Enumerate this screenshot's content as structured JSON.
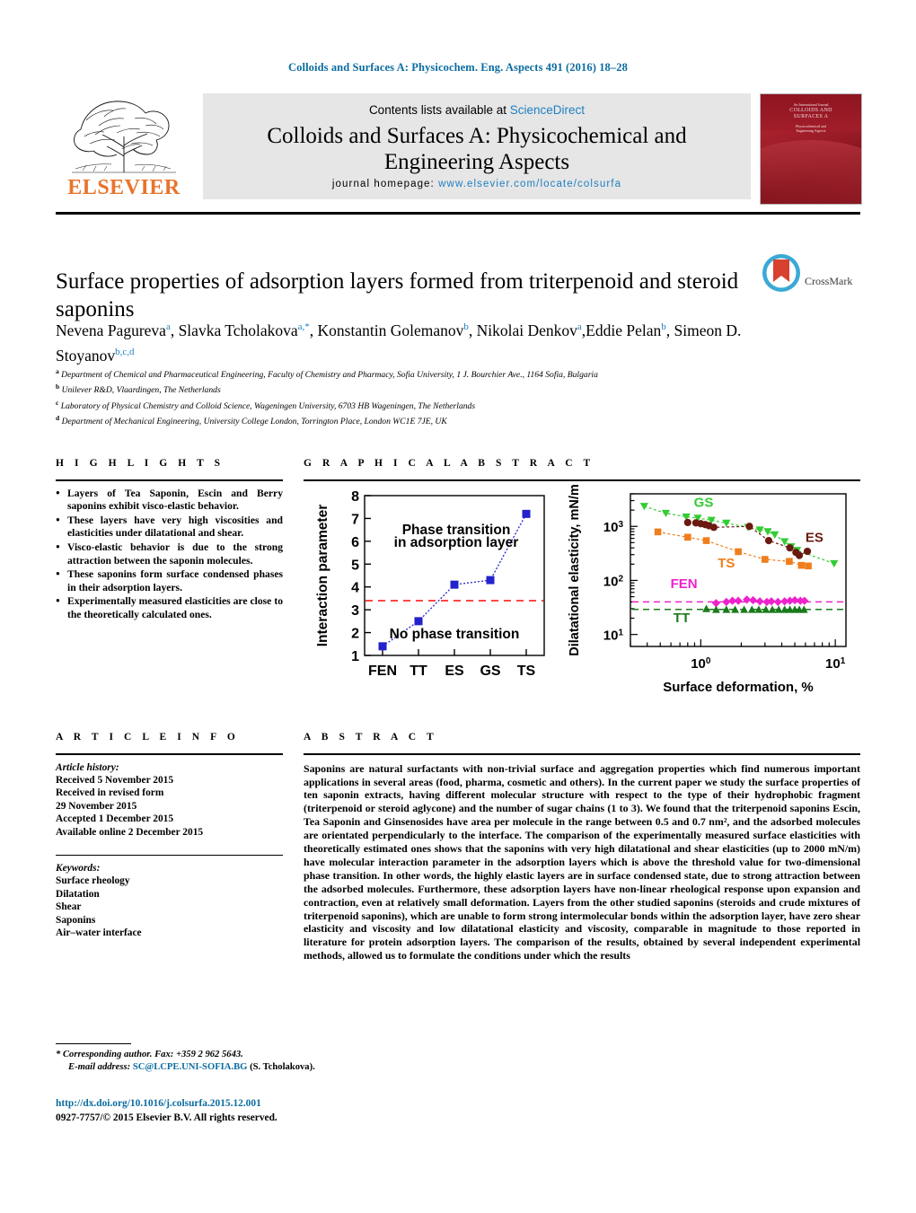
{
  "running_head": "Colloids and Surfaces A: Physicochem. Eng. Aspects 491 (2016) 18–28",
  "masthead": {
    "publisher": "ELSEVIER",
    "contents_prefix": "Contents lists available at ",
    "contents_link": "ScienceDirect",
    "journal_title_line1": "Colloids and Surfaces A: Physicochemical and",
    "journal_title_line2": "Engineering Aspects",
    "homepage_label": "journal homepage:",
    "homepage_url": "www.elsevier.com/locate/colsurfa",
    "cover_line1": "An International Journal",
    "cover_line2": "COLLOIDS AND",
    "cover_line3": "SURFACES A",
    "cover_line4": "Physicochemical and",
    "cover_line5": "Engineering Aspects"
  },
  "article": {
    "title": "Surface properties of adsorption layers formed from triterpenoid and steroid saponins",
    "authors": [
      {
        "name": "Nevena Pagureva",
        "sup": "a",
        "sep": ", "
      },
      {
        "name": "Slavka Tcholakova",
        "sup": "a,*",
        "sep": ", "
      },
      {
        "name": "Konstantin Golemanov",
        "sup": "b",
        "sep": ", "
      },
      {
        "name": "Nikolai Denkov",
        "sup": "a",
        "sep": ","
      },
      {
        "name": "Eddie Pelan",
        "sup": "b",
        "sep": ", "
      },
      {
        "name": "Simeon D. Stoyanov",
        "sup": "b,c,d",
        "sep": ""
      }
    ],
    "affiliations": [
      {
        "mark": "a",
        "text": "Department of Chemical and Pharmaceutical Engineering, Faculty of Chemistry and Pharmacy, Sofia University, 1 J. Bourchier Ave., 1164 Sofia, Bulgaria"
      },
      {
        "mark": "b",
        "text": "Unilever R&D, Vlaardingen, The Netherlands"
      },
      {
        "mark": "c",
        "text": "Laboratory of Physical Chemistry and Colloid Science, Wageningen University, 6703 HB Wageningen, The Netherlands"
      },
      {
        "mark": "d",
        "text": "Department of Mechanical Engineering, University College London, Torrington Place, London WC1E 7JE, UK"
      }
    ],
    "crossmark_label": "CrossMark"
  },
  "sections": {
    "highlights_heading": "H I G H L I G H T S",
    "graphical_abstract_heading": "G R A P H I C A L   A B S T R A C T",
    "article_info_heading": "A R T I C L E   I N F O",
    "abstract_heading": "A B S T R A C T"
  },
  "highlights": [
    "Layers of Tea Saponin, Escin and Berry saponins exhibit visco-elastic behavior.",
    "These layers have very high viscosities and elasticities under dilatational and shear.",
    "Visco-elastic behavior is due to the strong attraction between the saponin molecules.",
    "These saponins form surface condensed phases in their adsorption layers.",
    "Experimentally measured elasticities are close to the theoretically calculated ones."
  ],
  "article_info": {
    "history_label": "Article history:",
    "history": [
      "Received 5 November 2015",
      "Received in revised form",
      "29 November 2015",
      "Accepted 1 December 2015",
      "Available online 2 December 2015"
    ],
    "keywords_label": "Keywords:",
    "keywords": [
      "Surface rheology",
      "Dilatation",
      "Shear",
      "Saponins",
      "Air–water interface"
    ]
  },
  "abstract": "Saponins are natural surfactants with non-trivial surface and aggregation properties which find numerous important applications in several areas (food, pharma, cosmetic and others). In the current paper we study the surface properties of ten saponin extracts, having different molecular structure with respect to the type of their hydrophobic fragment (triterpenoid or steroid aglycone) and the number of sugar chains (1 to 3). We found that the triterpenoid saponins Escin, Tea Saponin and Ginsenosides have area per molecule in the range between 0.5 and 0.7 nm², and the adsorbed molecules are orientated perpendicularly to the interface. The comparison of the experimentally measured surface elasticities with theoretically estimated ones shows that the saponins with very high dilatational and shear elasticities (up to 2000 mN/m) have molecular interaction parameter in the adsorption layers which is above the threshold value for two-dimensional phase transition. In other words, the highly elastic layers are in surface condensed state, due to strong attraction between the adsorbed molecules. Furthermore, these adsorption layers have non-linear rheological response upon expansion and contraction, even at relatively small deformation. Layers from the other studied saponins (steroids and crude mixtures of triterpenoid saponins), which are unable to form strong intermolecular bonds within the adsorption layer, have zero shear elasticity and viscosity and low dilatational elasticity and viscosity, comparable in magnitude to those reported in literature for protein adsorption layers. The comparison of the results, obtained by several independent experimental methods, allowed us to formulate the conditions under which the results",
  "footer": {
    "corresponding_mark": "*",
    "corresponding": "Corresponding author. Fax: +359 2 962 5643.",
    "email_label": "E-mail address:",
    "email": "SC@LCPE.UNI-SOFIA.BG",
    "email_owner": "(S. Tcholakova).",
    "doi": "http://dx.doi.org/10.1016/j.colsurfa.2015.12.001",
    "copyright": "0927-7757/© 2015 Elsevier B.V. All rights reserved."
  },
  "chart_data": [
    {
      "type": "line",
      "id": "interaction-parameter-chart",
      "categories": [
        "FEN",
        "TT",
        "ES",
        "GS",
        "TS"
      ],
      "values": [
        1.4,
        2.5,
        4.1,
        4.3,
        7.2
      ],
      "series_color": "#2222cc",
      "marker": "square",
      "ylabel": "Interaction parameter",
      "xlabel": "",
      "ylim": [
        1,
        8
      ],
      "yticks": [
        1,
        2,
        3,
        4,
        5,
        6,
        7,
        8
      ],
      "threshold": {
        "value": 3.4,
        "color": "#ff2d2d",
        "style": "dashed"
      },
      "annotations": [
        {
          "text": "Phase transition",
          "x": 2.05,
          "y": 6.3
        },
        {
          "text": "in adsorption layer",
          "x": 2.05,
          "y": 5.75
        },
        {
          "text": "No phase transition",
          "x": 2.0,
          "y": 1.75
        }
      ],
      "grid": false,
      "legend": "none"
    },
    {
      "type": "scatter",
      "id": "dilatational-elasticity-chart",
      "xlabel": "Surface deformation, %",
      "ylabel": "Dilatational elasticity, mN/m",
      "xscale": "log",
      "yscale": "log",
      "xlim": [
        0.3,
        12
      ],
      "ylim": [
        6,
        4000
      ],
      "xticks": [
        "10⁰",
        "10¹"
      ],
      "yticks": [
        "10¹",
        "10²",
        "10³"
      ],
      "series": [
        {
          "name": "GS",
          "color": "#33cc33",
          "marker": "triangle-down",
          "label_pos": {
            "x": 1.05,
            "y": 2300
          },
          "points": [
            [
              0.38,
              2350
            ],
            [
              0.55,
              1750
            ],
            [
              0.78,
              1500
            ],
            [
              0.95,
              1420
            ],
            [
              1.2,
              1300
            ],
            [
              1.55,
              1150
            ],
            [
              2.25,
              960
            ],
            [
              2.75,
              860
            ],
            [
              3.15,
              800
            ],
            [
              3.55,
              700
            ],
            [
              4.2,
              520
            ],
            [
              4.7,
              420
            ],
            [
              5.2,
              360
            ],
            [
              9.8,
              205
            ]
          ]
        },
        {
          "name": "ES",
          "color": "#6b1a10",
          "marker": "circle",
          "label_pos": {
            "x": 7.0,
            "y": 520
          },
          "points": [
            [
              0.8,
              1180
            ],
            [
              0.92,
              1160
            ],
            [
              1.0,
              1120
            ],
            [
              1.08,
              1080
            ],
            [
              1.15,
              1030
            ],
            [
              1.25,
              960
            ],
            [
              2.3,
              1000
            ],
            [
              3.2,
              545
            ],
            [
              4.6,
              400
            ],
            [
              5.1,
              330
            ],
            [
              5.4,
              290
            ],
            [
              6.2,
              345
            ]
          ]
        },
        {
          "name": "TS",
          "color": "#ef7e1c",
          "marker": "square",
          "label_pos": {
            "x": 1.55,
            "y": 175
          },
          "points": [
            [
              0.48,
              790
            ],
            [
              0.8,
              630
            ],
            [
              1.1,
              545
            ],
            [
              1.9,
              340
            ],
            [
              3.0,
              245
            ],
            [
              4.55,
              225
            ],
            [
              5.6,
              190
            ],
            [
              6.3,
              185
            ]
          ]
        },
        {
          "name": "FEN",
          "color": "#ee22cc",
          "marker": "diamond",
          "label_pos": {
            "x": 0.75,
            "y": 72
          },
          "line_value": 40,
          "points": [
            [
              1.3,
              38
            ],
            [
              1.55,
              40
            ],
            [
              1.72,
              42
            ],
            [
              1.9,
              42
            ],
            [
              2.2,
              44
            ],
            [
              2.45,
              43
            ],
            [
              2.75,
              41
            ],
            [
              3.1,
              40
            ],
            [
              3.35,
              41
            ],
            [
              3.75,
              40
            ],
            [
              4.2,
              41
            ],
            [
              4.6,
              42
            ],
            [
              5.0,
              43
            ],
            [
              5.5,
              42
            ],
            [
              5.9,
              42
            ]
          ]
        },
        {
          "name": "TT",
          "color": "#1a7a1a",
          "marker": "triangle-up",
          "label_pos": {
            "x": 0.72,
            "y": 17
          },
          "line_value": 29,
          "points": [
            [
              1.1,
              30
            ],
            [
              1.3,
              29
            ],
            [
              1.55,
              29
            ],
            [
              1.8,
              29
            ],
            [
              2.1,
              29
            ],
            [
              2.4,
              29
            ],
            [
              2.7,
              29
            ],
            [
              3.05,
              29
            ],
            [
              3.4,
              29
            ],
            [
              3.8,
              29
            ],
            [
              4.2,
              29
            ],
            [
              4.6,
              29
            ],
            [
              5.0,
              29
            ],
            [
              5.4,
              29
            ],
            [
              5.85,
              29
            ]
          ]
        }
      ],
      "grid": false,
      "legend": "inline-labels"
    }
  ]
}
